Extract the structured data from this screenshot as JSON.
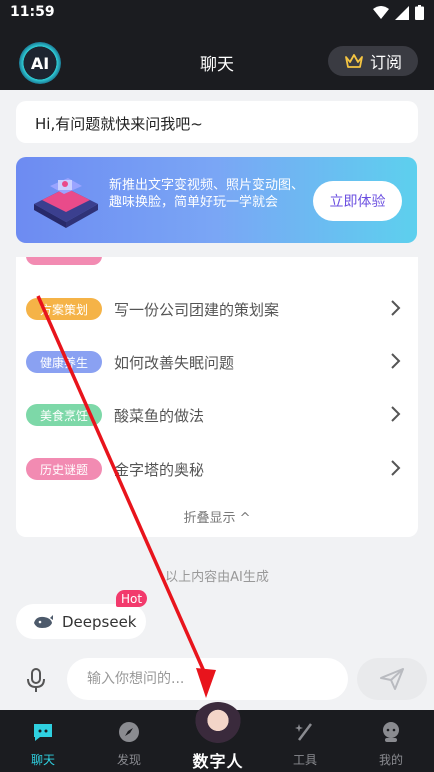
{
  "status_bar": {
    "time": "11:59"
  },
  "header": {
    "logo_text": "AI",
    "title": "聊天",
    "subscribe_label": "订阅"
  },
  "greeting": "Hi,有问题就快来问我吧~",
  "banner": {
    "text": "新推出文字变视频、照片变动图、趣味换脸，简单好玩一学就会",
    "button_label": "立即体验"
  },
  "suggestions": {
    "items": [
      {
        "tag": "方案策划",
        "tag_color": "#f5b347",
        "text": "写一份公司团建的策划案"
      },
      {
        "tag": "健康养生",
        "tag_color": "#8aa1f2",
        "text": "如何改善失眠问题"
      },
      {
        "tag": "美食烹饪",
        "tag_color": "#7dd8a8",
        "text": "酸菜鱼的做法"
      },
      {
        "tag": "历史谜题",
        "tag_color": "#f28bb2",
        "text": "金字塔的奥秘"
      }
    ],
    "collapse_label": "折叠显示 ^"
  },
  "ai_note": "以上内容由AI生成",
  "model_chip": {
    "label": "Deepseek",
    "badge": "Hot"
  },
  "composer": {
    "placeholder": "输入你想问的..."
  },
  "bottom_nav": {
    "items": [
      {
        "label": "聊天",
        "icon": "chat-icon",
        "active": true
      },
      {
        "label": "发现",
        "icon": "compass-icon",
        "active": false
      },
      {
        "label": "工具",
        "icon": "magic-wand-icon",
        "active": false
      },
      {
        "label": "我的",
        "icon": "profile-icon",
        "active": false
      }
    ],
    "center_label": "数字人"
  },
  "colors": {
    "accent": "#2fd0e0",
    "dark": "#1b1c20",
    "badge": "#f23a6c"
  }
}
